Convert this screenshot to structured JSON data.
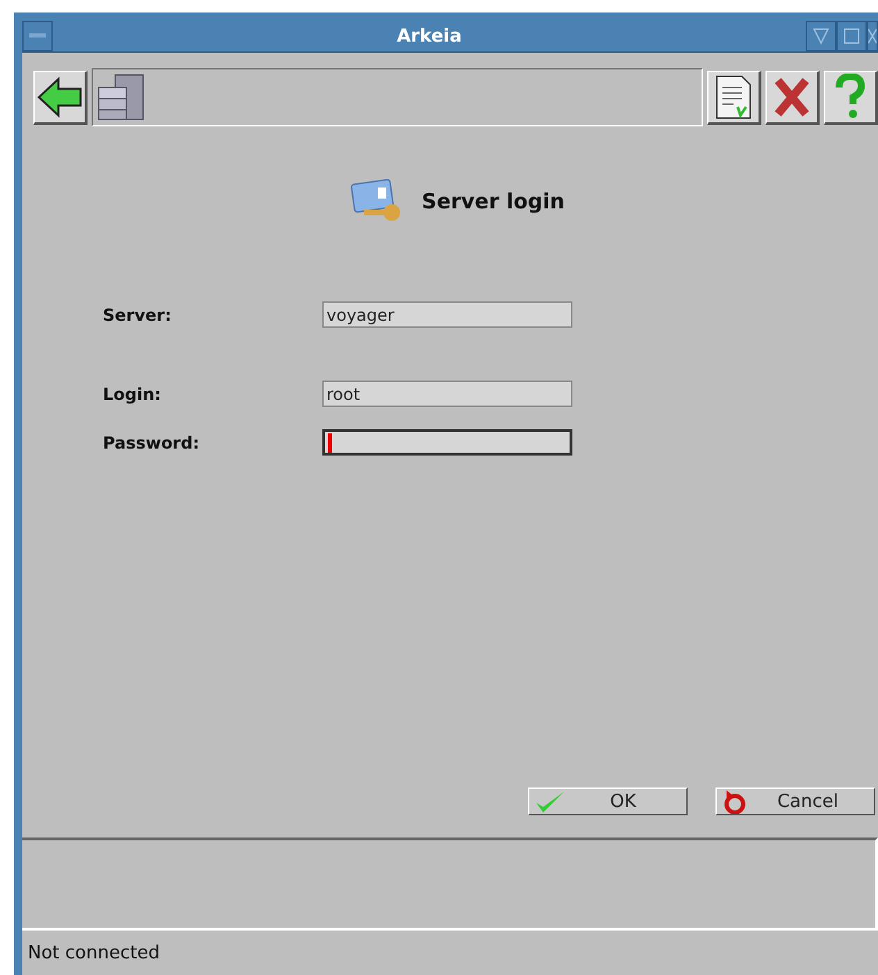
{
  "window": {
    "title": "Arkeia"
  },
  "heading": "Server login",
  "fields": [
    {
      "label": "Server:",
      "value": "voyager",
      "focused": false
    },
    {
      "label": "Login:",
      "value": "root",
      "focused": false
    },
    {
      "label": "Password:",
      "focused": true
    }
  ],
  "buttons": [
    {
      "label": "OK",
      "kind": "ok"
    },
    {
      "label": "Cancel",
      "kind": "cancel"
    }
  ],
  "status_bar": "Not connected"
}
